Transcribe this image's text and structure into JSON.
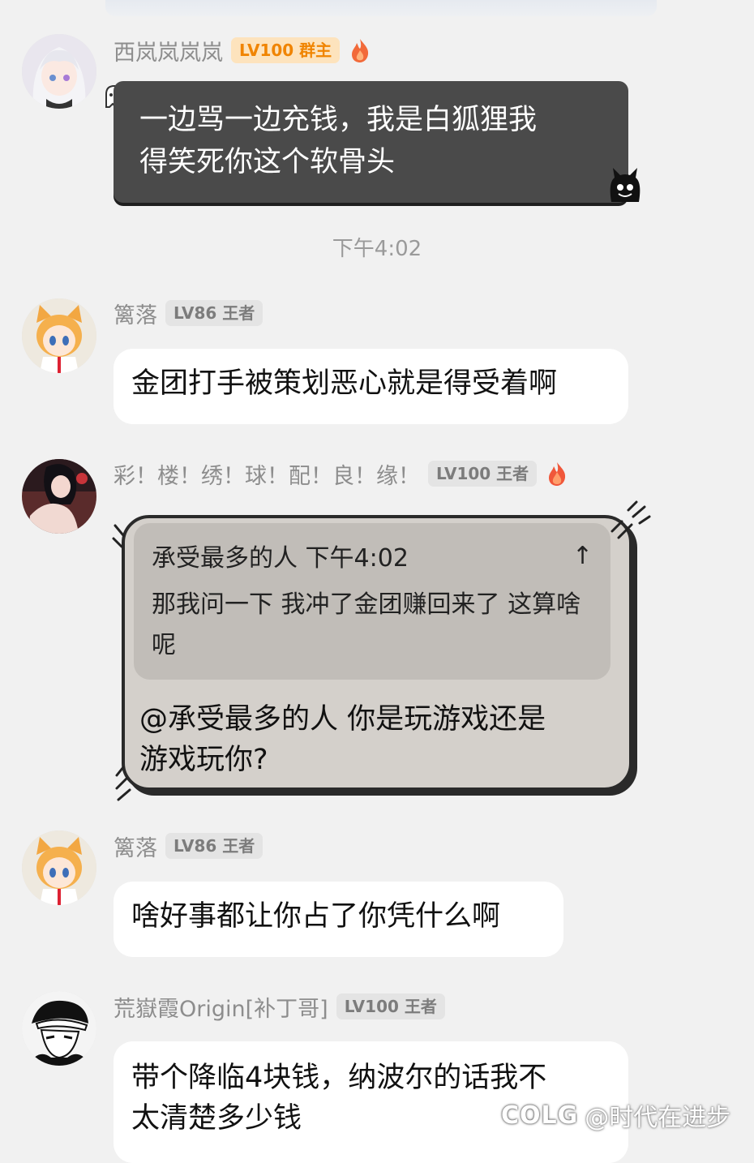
{
  "messages": [
    {
      "nick": "西岚岚岚岚",
      "badge": "LV100 群主",
      "text_lines": [
        "一边骂一边充钱，我是白狐狸我",
        "得笑死你这个软骨头"
      ]
    },
    {
      "nick": "篱落",
      "badge": "LV86 王者",
      "text": "金团打手被策划恶心就是得受着啊"
    },
    {
      "nick": "彩！楼！绣！球！配！良！缘！",
      "badge": "LV100 王者",
      "quote": {
        "author_time": "承受最多的人 下午4:02",
        "icon": "↑",
        "body": "那我问一下 我冲了金团赚回来了 这算啥呢"
      },
      "text_lines": [
        "@承受最多的人 你是玩游戏还是",
        "游戏玩你?"
      ]
    },
    {
      "nick": "篱落",
      "badge": "LV86 王者",
      "text": "啥好事都让你占了你凭什么啊"
    },
    {
      "nick": "荒嶽霞Origin[补丁哥]",
      "badge": "LV100 王者",
      "text_lines": [
        "带个降临4块钱，纳波尔的话我不",
        "太清楚多少钱"
      ]
    }
  ],
  "timestamp": "下午4:02",
  "watermark": {
    "logo": "COLG",
    "text": "@时代在进步"
  },
  "colors": {
    "background": "#f1f1f1",
    "owner_badge_bg": "#fde3bd",
    "owner_badge_text": "#f08400",
    "badge_bg": "#e4e4e4",
    "dark_bubble": "#4a4a4a"
  },
  "icons": {
    "fire": "fire-icon",
    "quote_pin": "arrow-up-icon"
  }
}
